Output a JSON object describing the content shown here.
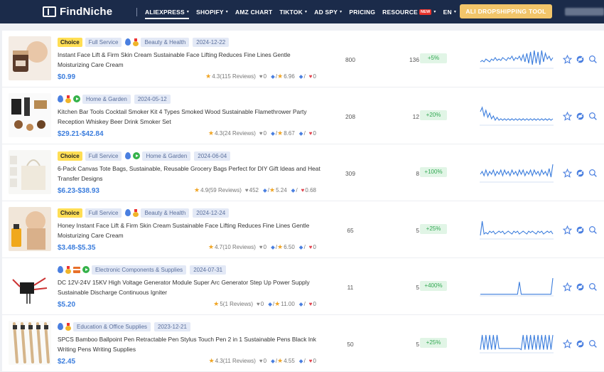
{
  "nav": {
    "brand": "FindNiche",
    "items": [
      {
        "label": "ALIEXPRESS",
        "caret": "▾",
        "active": true
      },
      {
        "label": "SHOPIFY",
        "caret": "▾"
      },
      {
        "label": "AMZ CHART",
        "caret": ""
      },
      {
        "label": "TIKTOK",
        "caret": "▾"
      },
      {
        "label": "AD SPY",
        "caret": "▾"
      },
      {
        "label": "PRICING",
        "caret": ""
      },
      {
        "label": "RESOURCE",
        "caret": "▾",
        "badge": "NEW"
      },
      {
        "label": "EN",
        "caret": "▾"
      }
    ],
    "cta": "ALI DROPSHIPPING TOOL"
  },
  "colors": {
    "accent": "#3b7ddd",
    "nav_bg": "#1b2b4a",
    "growth": "#32a852",
    "cta": "#f2c56a"
  },
  "products": [
    {
      "tags": [
        "Choice",
        "Full Service",
        "drop-icon",
        "medal-icon",
        "Beauty & Health",
        "2024-12-22"
      ],
      "title": "Instant Face Lift & Firm Skin Cream Sustainable Face Lifting Reduces Fine Lines Gentle Moisturizing Care Cream",
      "price": "$0.99",
      "rating": "4.3(115 Reviews)",
      "wishlist": "0",
      "score": "6.96",
      "dislikes": "0",
      "orders": "800",
      "sales": "136",
      "growth": "+5%",
      "trend": [
        4,
        5,
        4,
        6,
        5,
        4,
        6,
        5,
        7,
        5,
        6,
        5,
        7,
        6,
        5,
        7,
        6,
        8,
        5,
        7,
        6,
        8,
        5,
        9,
        4,
        10,
        3,
        11,
        2,
        12,
        3,
        11,
        2,
        12,
        4,
        10,
        6,
        8,
        5,
        7
      ]
    },
    {
      "tags": [
        "drop-icon",
        "medal-icon",
        "play-icon",
        "Home & Garden",
        "2024-05-12"
      ],
      "title": "Kitchen Bar Tools Cocktail Smoker Kit 4 Types Smoked Wood Sustainable Flamethrower Party Reception Whiskey Beer Drink Smoker Set",
      "price": "$29.21-$42.84",
      "rating": "4.3(24 Reviews)",
      "wishlist": "0",
      "score": "8.67",
      "dislikes": "0",
      "orders": "208",
      "sales": "12",
      "growth": "+20%",
      "trend": [
        9,
        12,
        6,
        10,
        5,
        8,
        4,
        6,
        3,
        5,
        3,
        4,
        3,
        4,
        3,
        4,
        3,
        4,
        3,
        4,
        3,
        4,
        3,
        4,
        3,
        4,
        3,
        4,
        3,
        4,
        3,
        4,
        3,
        4,
        3,
        4,
        3,
        4,
        3,
        4
      ]
    },
    {
      "tags": [
        "Choice",
        "Full Service",
        "drop-icon",
        "play-icon",
        "Home & Garden",
        "2024-06-04"
      ],
      "title": "6-Pack Canvas Tote Bags, Sustainable, Reusable Grocery Bags Perfect for DIY Gift Ideas and Heat Transfer Designs",
      "price": "$6.23-$38.93",
      "rating": "4.9(59 Reviews)",
      "wishlist": "452",
      "score": "5.24",
      "dislikes": "0.68",
      "orders": "309",
      "sales": "8",
      "growth": "+100%",
      "trend": [
        5,
        7,
        4,
        8,
        4,
        7,
        5,
        8,
        4,
        7,
        5,
        8,
        4,
        8,
        5,
        7,
        4,
        8,
        5,
        7,
        4,
        8,
        5,
        8,
        4,
        7,
        5,
        8,
        4,
        8,
        5,
        7,
        4,
        8,
        5,
        7,
        4,
        9,
        3,
        12
      ]
    },
    {
      "tags": [
        "Choice",
        "Full Service",
        "drop-icon",
        "medal-icon",
        "Beauty & Health",
        "2024-12-24"
      ],
      "title": "Honey Instant Face Lift & Firm Skin Cream Sustainable Face Lifting Reduces Fine Lines Gentle Moisturizing Care Cream",
      "price": "$3.48-$5.35",
      "rating": "4.7(10 Reviews)",
      "wishlist": "0",
      "score": "6.50",
      "dislikes": "0",
      "orders": "65",
      "sales": "5",
      "growth": "+25%",
      "trend": [
        2,
        12,
        3,
        4,
        3,
        5,
        4,
        5,
        3,
        4,
        5,
        4,
        5,
        3,
        4,
        5,
        4,
        3,
        5,
        4,
        5,
        3,
        4,
        5,
        4,
        3,
        5,
        4,
        5,
        4,
        3,
        5,
        4,
        5,
        3,
        4,
        5,
        4,
        5,
        3
      ]
    },
    {
      "tags": [
        "drop-icon",
        "medal-icon",
        "card-icon",
        "play-icon",
        "Electronic Components & Supplies",
        "2024-07-31"
      ],
      "title": "DC 12V-24V 15KV High Voltage Generator Module Super Arc Generator Step Up Power Supply Sustainable Discharge Continuous Igniter",
      "price": "$5.20",
      "rating": "5(1 Reviews)",
      "wishlist": "0",
      "score": "11.00",
      "dislikes": "0",
      "orders": "11",
      "sales": "5",
      "growth": "+400%",
      "trend": [
        1,
        1,
        1,
        1,
        1,
        1,
        1,
        1,
        1,
        1,
        1,
        1,
        1,
        1,
        1,
        1,
        1,
        1,
        1,
        1,
        1,
        14,
        1,
        1,
        1,
        1,
        1,
        1,
        1,
        1,
        1,
        1,
        1,
        1,
        1,
        1,
        1,
        1,
        1,
        18
      ]
    },
    {
      "tags": [
        "drop-icon",
        "medal-icon",
        "Education & Office Supplies",
        "2023-12-21"
      ],
      "title": "SPCS Bamboo Ballpoint Pen Retractable Pen Stylus Touch Pen 2 in 1 Sustainable Pens Black Ink Writing Pens Writing Supplies",
      "price": "$2.45",
      "rating": "4.3(11 Reviews)",
      "wishlist": "0",
      "score": "4.55",
      "dislikes": "0",
      "orders": "50",
      "sales": "5",
      "growth": "+25%",
      "trend": [
        2,
        14,
        2,
        14,
        2,
        14,
        2,
        14,
        2,
        14,
        3,
        3,
        3,
        3,
        3,
        3,
        3,
        3,
        3,
        3,
        3,
        3,
        2,
        14,
        2,
        14,
        2,
        14,
        2,
        14,
        2,
        14,
        2,
        14,
        2,
        14,
        2,
        14,
        2,
        14
      ]
    }
  ]
}
